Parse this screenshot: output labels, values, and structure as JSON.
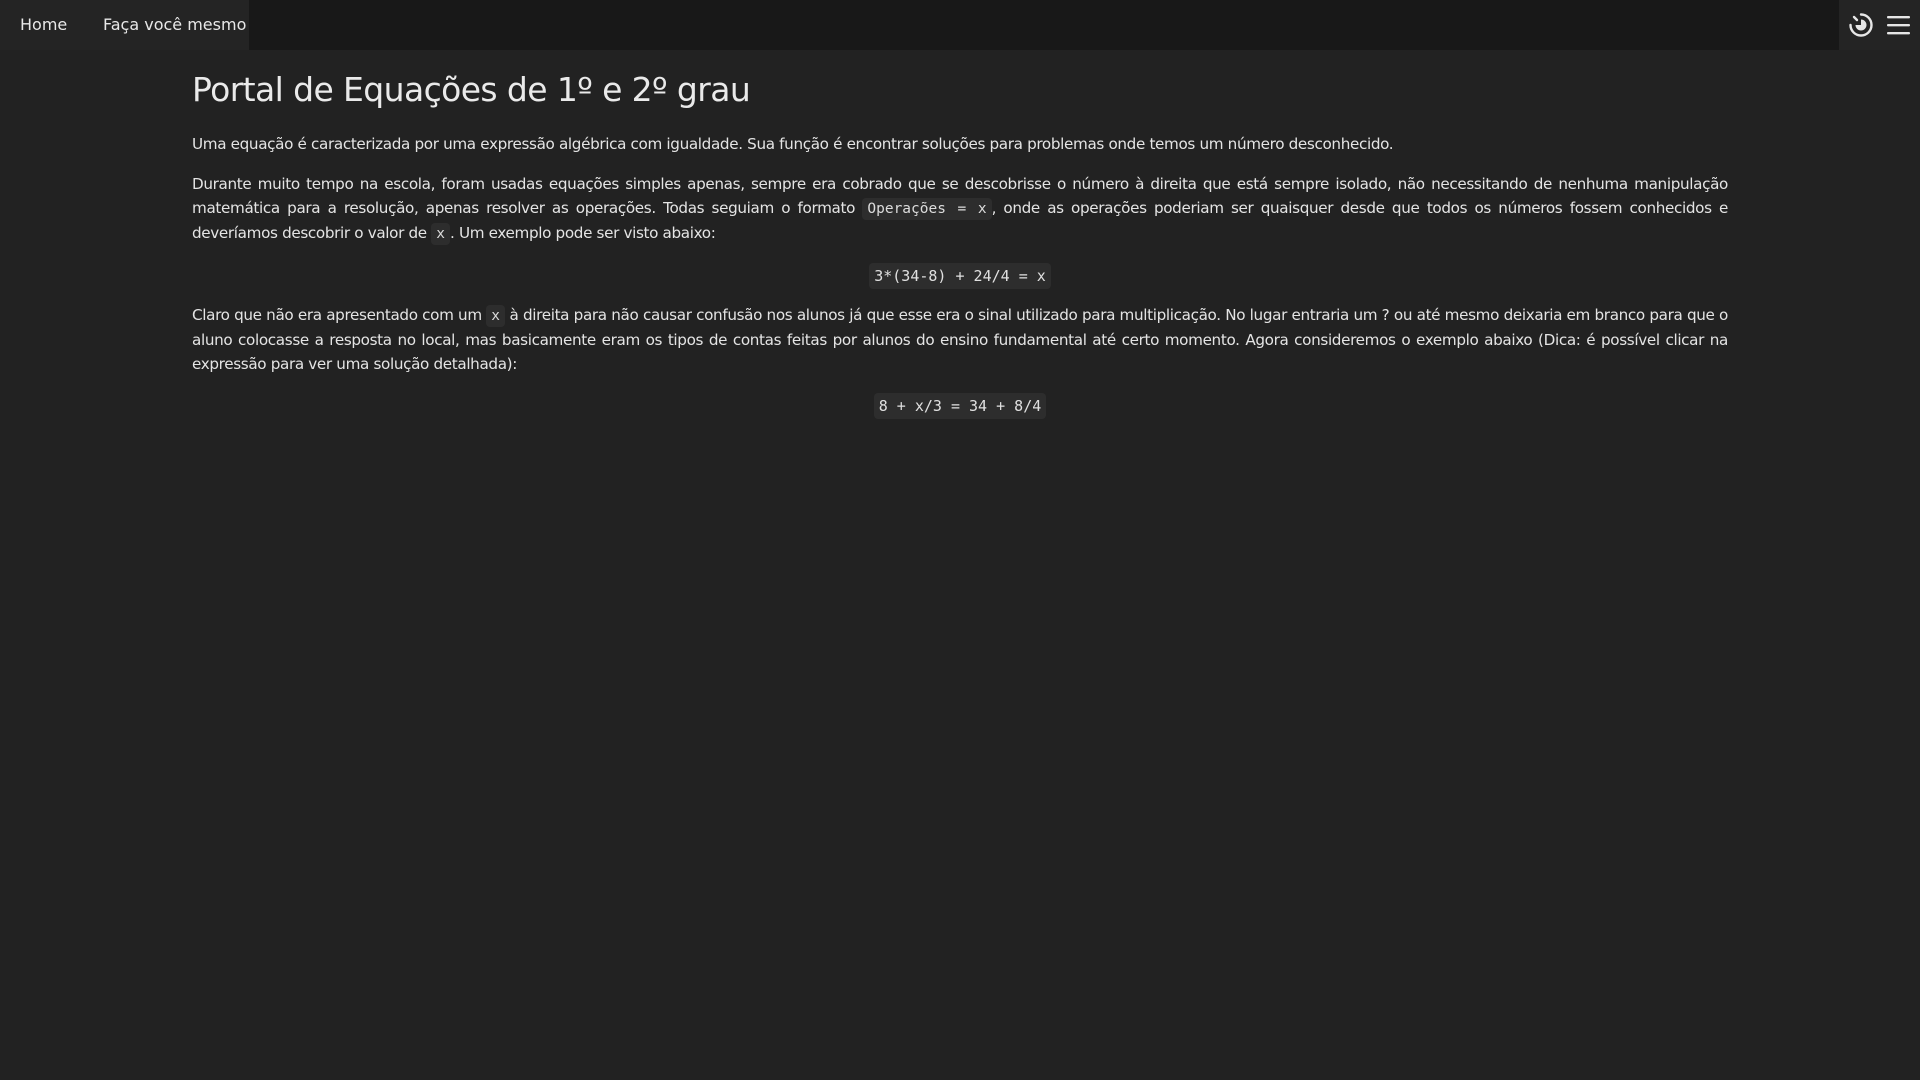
{
  "nav": {
    "home": "Home",
    "diy": "Faça você mesmo"
  },
  "icons": {
    "theme": "theme-toggle-icon",
    "menu": "hamburger-menu-icon"
  },
  "colors": {
    "background": "#222222",
    "topbar": "#181818",
    "nav_bg": "#242424",
    "text": "#e4e4e4",
    "code_bg": "#2d2d2d"
  },
  "main": {
    "title": "Portal de Equações de 1º e 2º grau",
    "p1": "Uma equação é caracterizada por uma expressão algébrica com igualdade. Sua função é encontrar soluções para problemas onde temos um número desconhecido.",
    "p2_a": "Durante muito tempo na escola, foram usadas equações simples apenas, sempre era cobrado que se descobrisse o número à direita que está sempre isolado, não necessitando de nenhuma manipulação matemática para a resolução, apenas resolver as operações. Todas seguiam o formato ",
    "p2_code1": "Operações = x",
    "p2_b": ", onde as operações poderiam ser quaisquer desde que todos os números fossem conhecidos e deveríamos descobrir o valor de ",
    "p2_code2": "x",
    "p2_c": ". Um exemplo pode ser visto abaixo:",
    "expr1": "3*(34-8) + 24/4 = x",
    "p3_a": "Claro que não era apresentado com um ",
    "p3_code": "x",
    "p3_b": " à direita para não causar confusão nos alunos já que esse era o sinal utilizado para multiplicação. No lugar entraria um ? ou até mesmo deixaria em branco para que o aluno colocasse a resposta no local, mas basicamente eram os tipos de contas feitas por alunos do ensino fundamental até certo momento. Agora consideremos o exemplo abaixo (Dica: é possível clicar na expressão para ver uma solução detalhada):",
    "expr2": "8 + x/3 = 34 + 8/4"
  }
}
